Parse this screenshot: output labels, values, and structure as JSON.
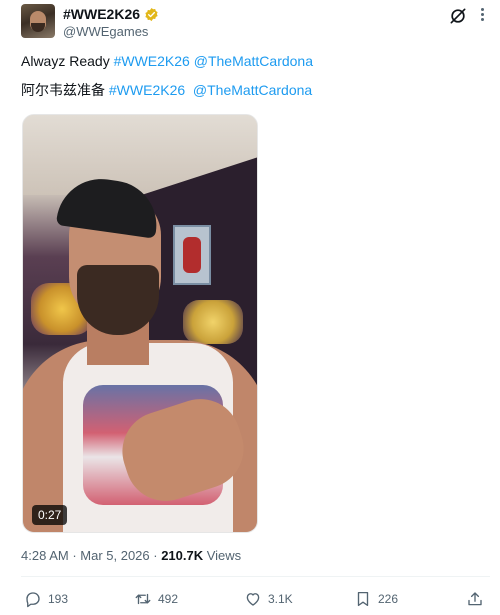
{
  "header": {
    "display_name": "#WWE2K26",
    "handle": "@WWEgames"
  },
  "tweet": {
    "line1_text": "Alwayz Ready ",
    "line1_hashtag": "#WWE2K26",
    "line1_mention": "@TheMattCardona",
    "line2_text": "阿尔韦兹准备 ",
    "line2_hashtag": "#WWE2K26",
    "line2_mention": "@TheMattCardona"
  },
  "media": {
    "duration": "0:27"
  },
  "meta": {
    "time": "4:28 AM",
    "separator": " · ",
    "date": "Mar 5, 2026",
    "views_count": "210.7K",
    "views_label": " Views"
  },
  "actions": {
    "replies": "193",
    "retweets": "492",
    "likes": "3.1K",
    "bookmarks": "226"
  },
  "colors": {
    "link": "#1d9bf0",
    "verified": "#e2b719",
    "secondary_text": "#536471"
  },
  "icons": [
    "verified-badge-icon",
    "grok-icon",
    "more-icon",
    "reply-icon",
    "retweet-icon",
    "like-icon",
    "bookmark-icon",
    "share-icon"
  ]
}
